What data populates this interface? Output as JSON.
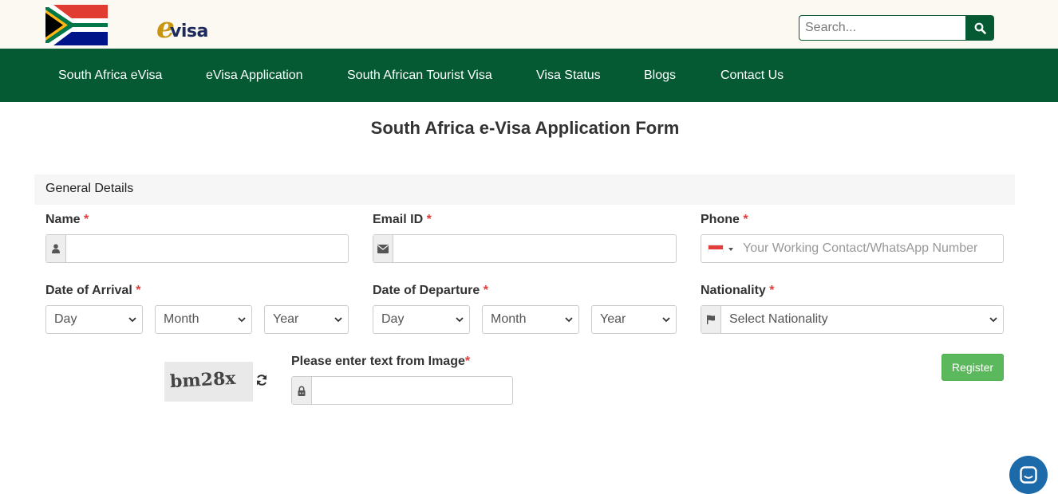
{
  "brand": {
    "logo_e": "e",
    "logo_visa": "visa"
  },
  "search": {
    "placeholder": "Search..."
  },
  "nav": {
    "items": [
      {
        "label": "South Africa eVisa"
      },
      {
        "label": "eVisa Application"
      },
      {
        "label": "South African Tourist Visa"
      },
      {
        "label": "Visa Status"
      },
      {
        "label": "Blogs"
      },
      {
        "label": "Contact Us"
      }
    ]
  },
  "page": {
    "title": "South Africa e-Visa Application Form"
  },
  "form": {
    "section_title": "General Details",
    "required_mark": "*",
    "name": {
      "label": "Name",
      "value": ""
    },
    "email": {
      "label": "Email ID",
      "value": ""
    },
    "phone": {
      "label": "Phone",
      "placeholder": "Your Working Contact/WhatsApp Number",
      "value": ""
    },
    "arrival": {
      "label": "Date of Arrival",
      "day": "Day",
      "month": "Month",
      "year": "Year"
    },
    "departure": {
      "label": "Date of Departure",
      "day": "Day",
      "month": "Month",
      "year": "Year"
    },
    "nationality": {
      "label": "Nationality",
      "selected": "Select Nationality"
    },
    "captcha": {
      "label": "Please enter text from Image",
      "image_text": "bm28x",
      "value": ""
    },
    "register_label": "Register"
  },
  "colors": {
    "primary_green": "#055a33",
    "register_green": "#5cb85c",
    "required_red": "#e23c3c",
    "chat_blue": "#1d6aaa",
    "topbar_bg": "#fbf9f1"
  },
  "icons": {
    "search": "search-icon",
    "name_addon": "user-icon",
    "email_addon": "envelope-icon",
    "nationality_addon": "flag-icon",
    "captcha_addon": "lock-icon",
    "refresh": "refresh-icon",
    "chat": "chat-icon"
  }
}
